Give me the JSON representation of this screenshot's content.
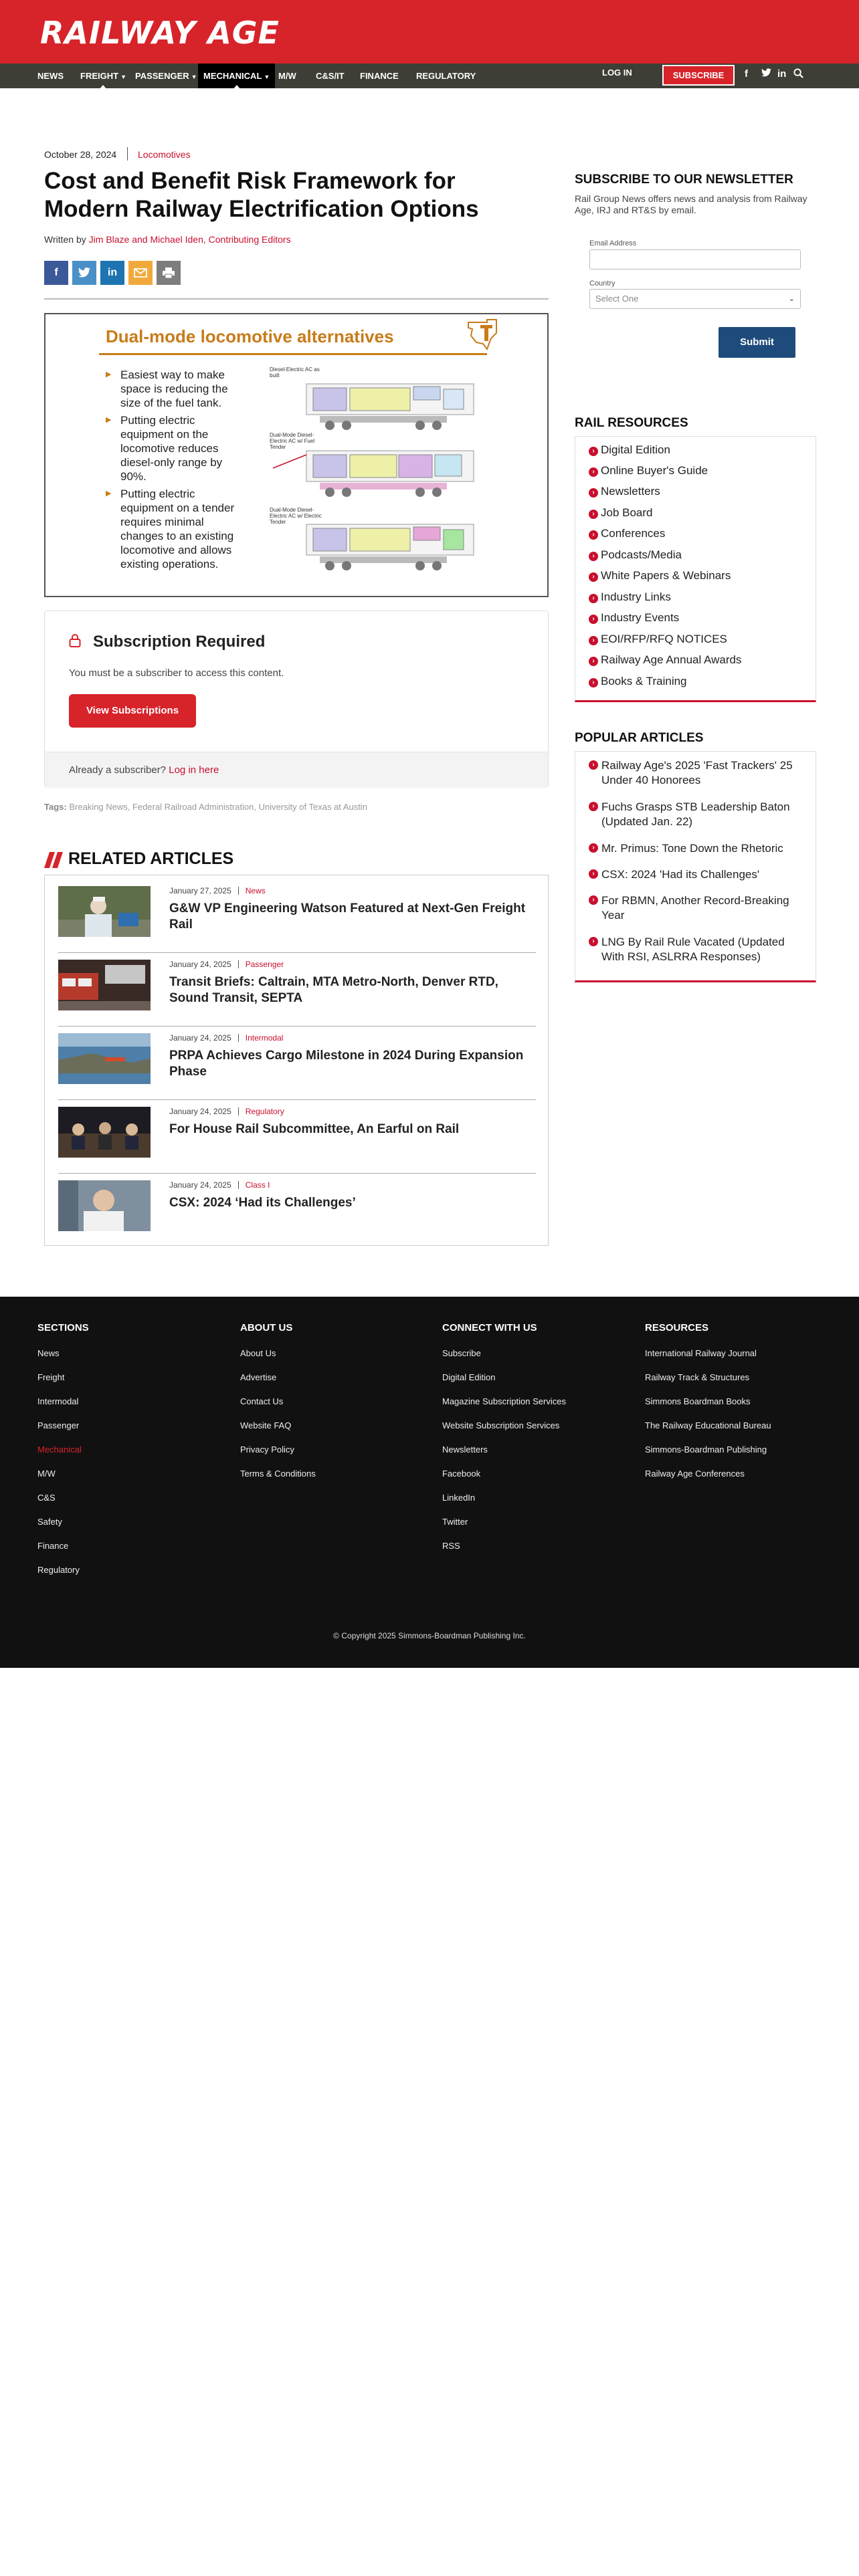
{
  "site": {
    "logo_text": "RAILWAY AGE"
  },
  "nav": {
    "items": [
      {
        "label": "NEWS"
      },
      {
        "label": "FREIGHT"
      },
      {
        "label": "PASSENGER"
      },
      {
        "label": "MECHANICAL"
      },
      {
        "label": "M/W"
      },
      {
        "label": "C&S/IT"
      },
      {
        "label": "FINANCE"
      },
      {
        "label": "REGULATORY"
      }
    ],
    "login_label": "LOG IN",
    "subscribe_label": "SUBSCRIBE",
    "social": [
      "f",
      "t",
      "in"
    ]
  },
  "article": {
    "date": "October 28, 2024",
    "category": "Locomotives",
    "title": "Cost and Benefit Risk Framework for Modern Railway Electrification Options",
    "byline_prefix": "Written by ",
    "authors": "Jim Blaze and Michael Iden, Contributing Editors",
    "share_icons": [
      "facebook-icon",
      "twitter-icon",
      "linkedin-icon",
      "email-icon",
      "print-icon"
    ],
    "figure": {
      "title": "Dual-mode locomotive alternatives",
      "bullets": [
        "Easiest way to make space is reducing the size of the fuel tank.",
        "Putting electric equipment on the locomotive reduces diesel-only range by 90%.",
        "Putting electric equipment on a tender requires minimal changes to an existing locomotive and allows existing operations."
      ],
      "diagram_labels": [
        "Diesel-Electric AC as built",
        "Dual-Mode Diesel-Electric AC w/ Fuel Tender",
        "Dual-Mode Diesel-Electric AC w/ Electric Tender"
      ]
    }
  },
  "paywall": {
    "title": "Subscription Required",
    "text": "You must be a subscriber to access this content.",
    "button_label": "View Subscriptions",
    "already_text": "Already a subscriber?",
    "login_link": "Log in here"
  },
  "tags": {
    "label": "Tags:",
    "items": "Breaking News, Federal Railroad Administration, University of Texas at Austin"
  },
  "related": {
    "title": "RELATED ARTICLES",
    "items": [
      {
        "date": "January 27, 2025",
        "category": "News",
        "title": "G&W VP Engineering Watson Featured at Next-Gen Freight Rail"
      },
      {
        "date": "January 24, 2025",
        "category": "Passenger",
        "title": "Transit Briefs: Caltrain, MTA Metro-North, Denver RTD, Sound Transit, SEPTA"
      },
      {
        "date": "January 24, 2025",
        "category": "Intermodal",
        "title": "PRPA Achieves Cargo Milestone in 2024 During Expansion Phase"
      },
      {
        "date": "January 24, 2025",
        "category": "Regulatory",
        "title": "For House Rail Subcommittee, An Earful on Rail"
      },
      {
        "date": "January 24, 2025",
        "category": "Class I",
        "title": "CSX: 2024 ‘Had its Challenges’"
      }
    ]
  },
  "newsletter": {
    "title": "SUBSCRIBE TO OUR NEWSLETTER",
    "text": "Rail Group News offers news and analysis from Railway Age, IRJ and RT&S by email.",
    "email_label": "Email Address",
    "country_label": "Country",
    "country_value": "Select One",
    "submit_label": "Submit"
  },
  "rail_resources": {
    "title": "RAIL RESOURCES",
    "items": [
      "Digital Edition",
      "Online Buyer's Guide",
      "Newsletters",
      "Job Board",
      "Conferences",
      "Podcasts/Media",
      "White Papers & Webinars",
      "Industry Links",
      "Industry Events",
      "EOI/RFP/RFQ NOTICES",
      "Railway Age Annual Awards",
      "Books & Training"
    ]
  },
  "popular": {
    "title": "POPULAR ARTICLES",
    "items": [
      "Railway Age's 2025 'Fast Trackers' 25 Under 40 Honorees",
      "Fuchs Grasps STB Leadership Baton (Updated Jan. 22)",
      "Mr. Primus: Tone Down the Rhetoric",
      "CSX: 2024 'Had its Challenges'",
      "For RBMN, Another Record-Breaking Year",
      "LNG By Rail Rule Vacated (Updated With RSI, ASLRRA Responses)"
    ]
  },
  "footer": {
    "sections": {
      "title": "SECTIONS",
      "links": [
        "News",
        "Freight",
        "Intermodal",
        "Passenger",
        "Mechanical",
        "M/W",
        "C&S",
        "Safety",
        "Finance",
        "Regulatory"
      ]
    },
    "about": {
      "title": "ABOUT US",
      "links": [
        "About Us",
        "Advertise",
        "Contact Us",
        "Website FAQ",
        "Privacy Policy",
        "Terms & Conditions"
      ]
    },
    "connect": {
      "title": "CONNECT WITH US",
      "links": [
        "Subscribe",
        "Digital Edition",
        "Magazine Subscription Services",
        "Website Subscription Services",
        "Newsletters",
        "Facebook",
        "LinkedIn",
        "Twitter",
        "RSS"
      ]
    },
    "resources": {
      "title": "RESOURCES",
      "links": [
        "International Railway Journal",
        "Railway Track & Structures",
        "Simmons Boardman Books",
        "The Railway Educational Bureau",
        "Simmons-Boardman Publishing",
        "Railway Age Conferences"
      ]
    },
    "copyright": "© Copyright 2025 Simmons-Boardman Publishing Inc."
  },
  "colors": {
    "brand_red": "#d7232a",
    "nav_bg": "#3d3f36",
    "accent_red": "#c8102e",
    "submit_blue": "#1e4b7c",
    "footer_bg": "#111111",
    "figure_orange": "#c87c1a"
  }
}
